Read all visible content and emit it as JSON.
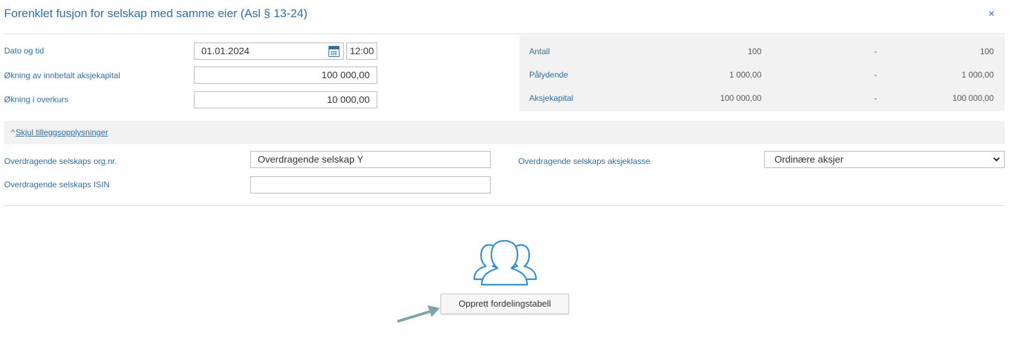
{
  "dialog": {
    "title": "Forenklet fusjon for selskap med samme eier (Asl § 13-24)",
    "close_glyph": "×"
  },
  "form": {
    "date_time_label": "Dato og tid",
    "date_value": "01.01.2024",
    "time_value": "12:00",
    "paid_in_capital_label": "Økning av innbetalt aksjekapital",
    "paid_in_capital_value": "100 000,00",
    "premium_label": "Økning i overkurs",
    "premium_value": "10 000,00"
  },
  "summary": {
    "rows": [
      {
        "label": "Antall",
        "from": "100",
        "sep": "-",
        "to": "100"
      },
      {
        "label": "Pålydende",
        "from": "1 000,00",
        "sep": "-",
        "to": "1 000,00"
      },
      {
        "label": "Aksjekapital",
        "from": "100 000,00",
        "sep": "-",
        "to": "100 000,00"
      }
    ]
  },
  "toggle": {
    "caret": "^",
    "label": "Skjul tilleggsopplysninger"
  },
  "additional": {
    "org_nr_label": "Overdragende selskaps org.nr.",
    "org_nr_value": "Overdragende selskap Y",
    "isin_label": "Overdragende selskaps ISIN",
    "isin_value": "",
    "share_class_label": "Overdragende selskaps aksjeklasse",
    "share_class_value": "Ordinære aksjer"
  },
  "action": {
    "icon": "people-group-icon",
    "button_label": "Opprett fordelingstabell",
    "accent": "#2b8fd6",
    "arrow_color": "#7aa6aa"
  }
}
